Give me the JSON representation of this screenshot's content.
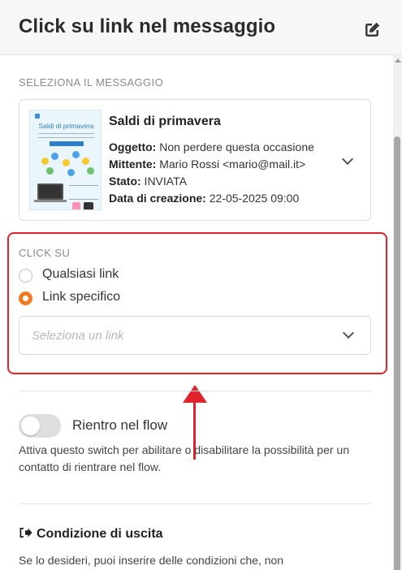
{
  "header": {
    "title": "Click su link nel messaggio",
    "edit_icon": "edit-icon"
  },
  "message_section": {
    "label": "SELEZIONA IL MESSAGGIO",
    "card": {
      "title": "Saldi di primavera",
      "thumbnail_title": "Saldi di primavera",
      "subject_label": "Oggetto:",
      "subject_value": " Non perdere questa occasione",
      "sender_label": "Mittente:",
      "sender_value": " Mario Rossi <mario@mail.it>",
      "status_label": "Stato:",
      "status_value": " INVIATA",
      "created_label": "Data di creazione:",
      "created_value": " 22-05-2025 09:00"
    }
  },
  "click_section": {
    "label": "CLICK SU",
    "options": [
      {
        "label": "Qualsiasi link",
        "selected": false
      },
      {
        "label": "Link specifico",
        "selected": true
      }
    ],
    "select_placeholder": "Seleziona un link"
  },
  "reentry": {
    "label": "Rientro nel flow",
    "enabled": false,
    "help": "Attiva questo switch per abilitare o disabilitare la possibilità per un contatto di rientrare nel flow."
  },
  "exit": {
    "title": "Condizione di uscita",
    "text": "Se lo desideri, puoi inserire delle condizioni che, non"
  },
  "colors": {
    "accent": "#f47a21",
    "highlight": "#e0232b"
  }
}
